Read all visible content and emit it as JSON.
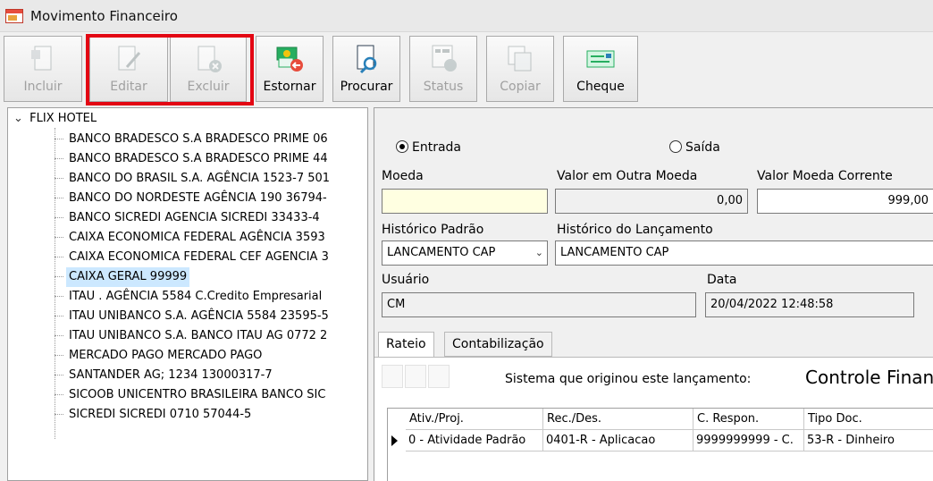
{
  "window": {
    "title": "Movimento Financeiro"
  },
  "toolbar": {
    "incluir": "Incluir",
    "editar": "Editar",
    "excluir": "Excluir",
    "estornar": "Estornar",
    "procurar": "Procurar",
    "status": "Status",
    "copiar": "Copiar",
    "cheque": "Cheque"
  },
  "tree": {
    "root": "FLIX HOTEL",
    "items": [
      "BANCO BRADESCO S.A BRADESCO PRIME 06",
      "BANCO BRADESCO S.A BRADESCO PRIME 44",
      "BANCO DO BRASIL S.A. AGÊNCIA 1523-7 501",
      "BANCO DO NORDESTE AGÊNCIA 190 36794-",
      "BANCO SICREDI AGENCIA SICREDI 33433-4",
      "CAIXA ECONOMICA FEDERAL AGÊNCIA 3593",
      "CAIXA ECONOMICA FEDERAL CEF AGENCIA 3",
      "CAIXA GERAL 99999",
      "ITAU . AGÊNCIA 5584 C.Credito Empresarial",
      "ITAU UNIBANCO S.A. AGÊNCIA 5584 23595-5",
      "ITAU UNIBANCO S.A. BANCO ITAU AG 0772 2",
      "MERCADO PAGO MERCADO PAGO",
      "SANTANDER AG; 1234 13000317-7",
      "SICOOB UNICENTRO BRASILEIRA BANCO SIC",
      "SICREDI SICREDI 0710 57044-5"
    ],
    "selected": "CAIXA GERAL 99999"
  },
  "form": {
    "entrada": "Entrada",
    "saida": "Saída",
    "moeda_label": "Moeda",
    "moeda_value": "",
    "valor_outra_label": "Valor em Outra Moeda",
    "valor_outra_value": "0,00",
    "valor_corrente_label": "Valor Moeda Corrente",
    "valor_corrente_value": "999,00",
    "hist_padrao_label": "Histórico Padrão",
    "hist_padrao_value": "LANCAMENTO CAP",
    "hist_lanc_label": "Histórico do Lançamento",
    "hist_lanc_value": "LANCAMENTO CAP",
    "usuario_label": "Usuário",
    "usuario_value": "CM",
    "data_label": "Data",
    "data_value": "20/04/2022 12:48:58"
  },
  "tabs": {
    "rateio": "Rateio",
    "contabilizacao": "Contabilização"
  },
  "rateio": {
    "sistema_label": "Sistema que originou este lançamento:",
    "sistema_value": "Controle Financeiro",
    "headers": [
      "Ativ./Proj.",
      "Rec./Des.",
      "C. Respon.",
      "Tipo Doc."
    ],
    "row": [
      "0 - Atividade Padrão",
      "0401-R - Aplicacao",
      "9999999999 - C.",
      "53-R - Dinheiro"
    ]
  }
}
